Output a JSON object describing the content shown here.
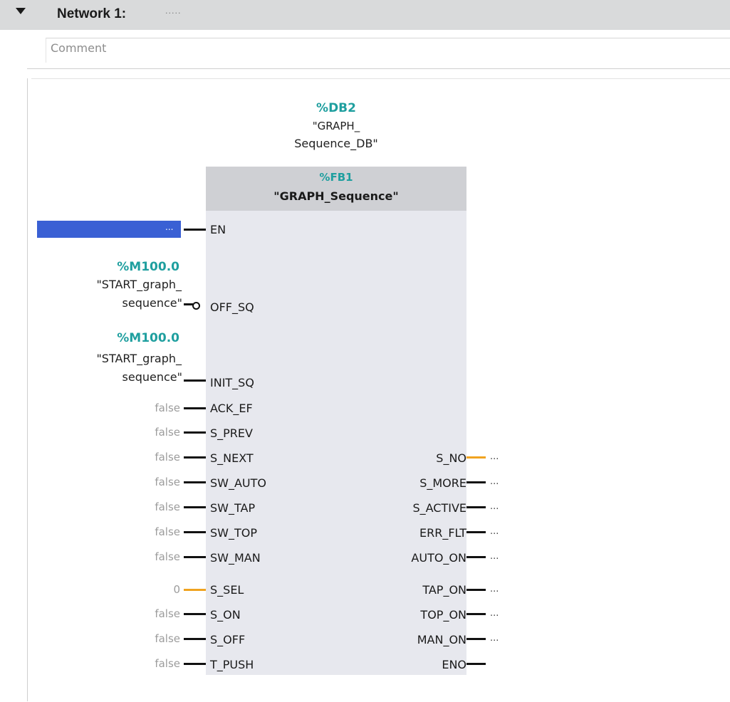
{
  "network": {
    "title": "Network 1:",
    "title_dots": ".....",
    "comment_placeholder": "Comment"
  },
  "instance_db": {
    "address": "%DB2",
    "name_line1": "\"GRAPH_",
    "name_line2": "Sequence_DB\""
  },
  "function_block": {
    "address": "%FB1",
    "name": "\"GRAPH_Sequence\""
  },
  "en_input": {
    "value": "..."
  },
  "tags": [
    {
      "address": "%M100.0",
      "name_line1": "\"START_graph_",
      "name_line2": "sequence\""
    },
    {
      "address": "%M100.0",
      "name_line1": "\"START_graph_",
      "name_line2": "sequence\""
    }
  ],
  "inputs": [
    {
      "pin": "EN"
    },
    {
      "pin": "OFF_SQ",
      "negated": true
    },
    {
      "pin": "INIT_SQ"
    },
    {
      "pin": "ACK_EF",
      "value": "false"
    },
    {
      "pin": "S_PREV",
      "value": "false"
    },
    {
      "pin": "S_NEXT",
      "value": "false"
    },
    {
      "pin": "SW_AUTO",
      "value": "false"
    },
    {
      "pin": "SW_TAP",
      "value": "false"
    },
    {
      "pin": "SW_TOP",
      "value": "false"
    },
    {
      "pin": "SW_MAN",
      "value": "false"
    },
    {
      "pin": "S_SEL",
      "value": "0"
    },
    {
      "pin": "S_ON",
      "value": "false"
    },
    {
      "pin": "S_OFF",
      "value": "false"
    },
    {
      "pin": "T_PUSH",
      "value": "false"
    }
  ],
  "outputs": [
    {
      "pin": "S_NO",
      "value": "..."
    },
    {
      "pin": "S_MORE",
      "value": "..."
    },
    {
      "pin": "S_ACTIVE",
      "value": "..."
    },
    {
      "pin": "ERR_FLT",
      "value": "..."
    },
    {
      "pin": "AUTO_ON",
      "value": "..."
    },
    {
      "pin": "TAP_ON",
      "value": "..."
    },
    {
      "pin": "TOP_ON",
      "value": "..."
    },
    {
      "pin": "MAN_ON",
      "value": "..."
    },
    {
      "pin": "ENO"
    }
  ],
  "colors": {
    "header_bg": "#d9dadb",
    "block_body": "#e7e8ee",
    "block_header": "#cfd0d4",
    "address_teal": "#1f9f9f",
    "en_selected_blue": "#3a60d4",
    "int_wire_orange": "#f0a320"
  }
}
